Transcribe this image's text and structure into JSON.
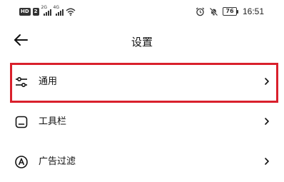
{
  "status_bar": {
    "hd_badge": "HD",
    "sim_badge": "2",
    "signal1_tag": "2G",
    "signal2_tag": "4G",
    "battery_level": "76",
    "time": "16:51"
  },
  "header": {
    "back_icon": "arrow-left-icon",
    "title": "设置"
  },
  "menu": {
    "items": [
      {
        "label": "通用",
        "icon": "sliders-icon",
        "highlighted": true
      },
      {
        "label": "工具栏",
        "icon": "toolbar-icon",
        "highlighted": false
      },
      {
        "label": "广告过滤",
        "icon": "ad-block-icon",
        "highlighted": false
      }
    ]
  },
  "colors": {
    "highlight": "#d9202c",
    "text": "#111111",
    "background": "#ffffff"
  }
}
